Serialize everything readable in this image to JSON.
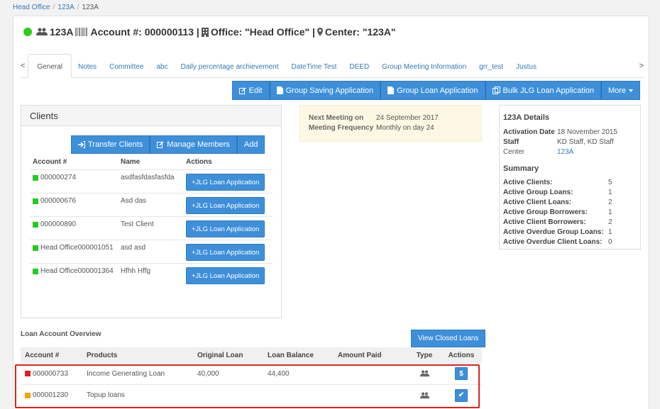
{
  "breadcrumb": [
    "Head Office",
    "123A",
    "123A"
  ],
  "header": {
    "group_name": "123A",
    "account_text": "Account #: 000000113 |",
    "office_text": "Office: \"Head Office\" |",
    "center_text": "Center: \"123A\""
  },
  "tabs": {
    "prev": "<",
    "next": ">",
    "items": [
      "General",
      "Notes",
      "Committee",
      "abc",
      "Daily percentage archievement",
      "DateTime Test",
      "DEED",
      "Group Meeting Information",
      "grr_test",
      "Justus"
    ]
  },
  "actions": {
    "edit": "Edit",
    "group_saving": "Group Saving Application",
    "group_loan": "Group Loan Application",
    "bulk_jlg": "Bulk JLG Loan Application",
    "more": "More"
  },
  "clients": {
    "title": "Clients",
    "transfer": "Transfer Clients",
    "manage": "Manage Members",
    "add": "Add",
    "columns": [
      "Account #",
      "Name",
      "Actions"
    ],
    "action_label": "+JLG Loan Application",
    "rows": [
      {
        "account": "000000274",
        "name": "asdfasfdasfasfda"
      },
      {
        "account": "000000676",
        "name": "Asd das"
      },
      {
        "account": "000000890",
        "name": "Test Client"
      },
      {
        "account": "Head Office000001051",
        "name": "asd asd"
      },
      {
        "account": "Head Office000001364",
        "name": "Hfhh Hffg"
      }
    ],
    "status_color": "#22cc22"
  },
  "meeting": {
    "next_label": "Next Meeting on",
    "next_value": "24 September 2017",
    "freq_label": "Meeting Frequency",
    "freq_value": "Monthly on day 24"
  },
  "details": {
    "title": "123A Details",
    "activation_label": "Activation Date",
    "activation_value": "18 November 2015",
    "staff_label": "Staff",
    "staff_value": "KD Staff, KD Staff",
    "center_label": "Center",
    "center_value": "123A",
    "summary_title": "Summary",
    "summary": [
      {
        "label": "Active Clients:",
        "value": "5"
      },
      {
        "label": "Active Group Loans:",
        "value": "1"
      },
      {
        "label": "Active Client Loans:",
        "value": "2"
      },
      {
        "label": "Active Group Borrowers:",
        "value": "1"
      },
      {
        "label": "Active Client Borrowers:",
        "value": "2"
      },
      {
        "label": "Active Overdue Group Loans:",
        "value": "1"
      },
      {
        "label": "Active Overdue Client Loans:",
        "value": "0"
      }
    ]
  },
  "loans": {
    "title": "Loan Account Overview",
    "view_closed": "View Closed Loans",
    "columns": [
      "Account #",
      "Products",
      "Original Loan",
      "Loan Balance",
      "Amount Paid",
      "Type",
      "Actions"
    ],
    "rows": [
      {
        "account": "000000733",
        "product": "Income Generating Loan",
        "original": "40,000",
        "balance": "44,400",
        "paid": "",
        "status_color": "#e02020",
        "action_icon": "$"
      },
      {
        "account": "000001230",
        "product": "Topup loans",
        "original": "",
        "balance": "",
        "paid": "",
        "status_color": "#f0a500",
        "action_icon": "✔"
      }
    ]
  }
}
